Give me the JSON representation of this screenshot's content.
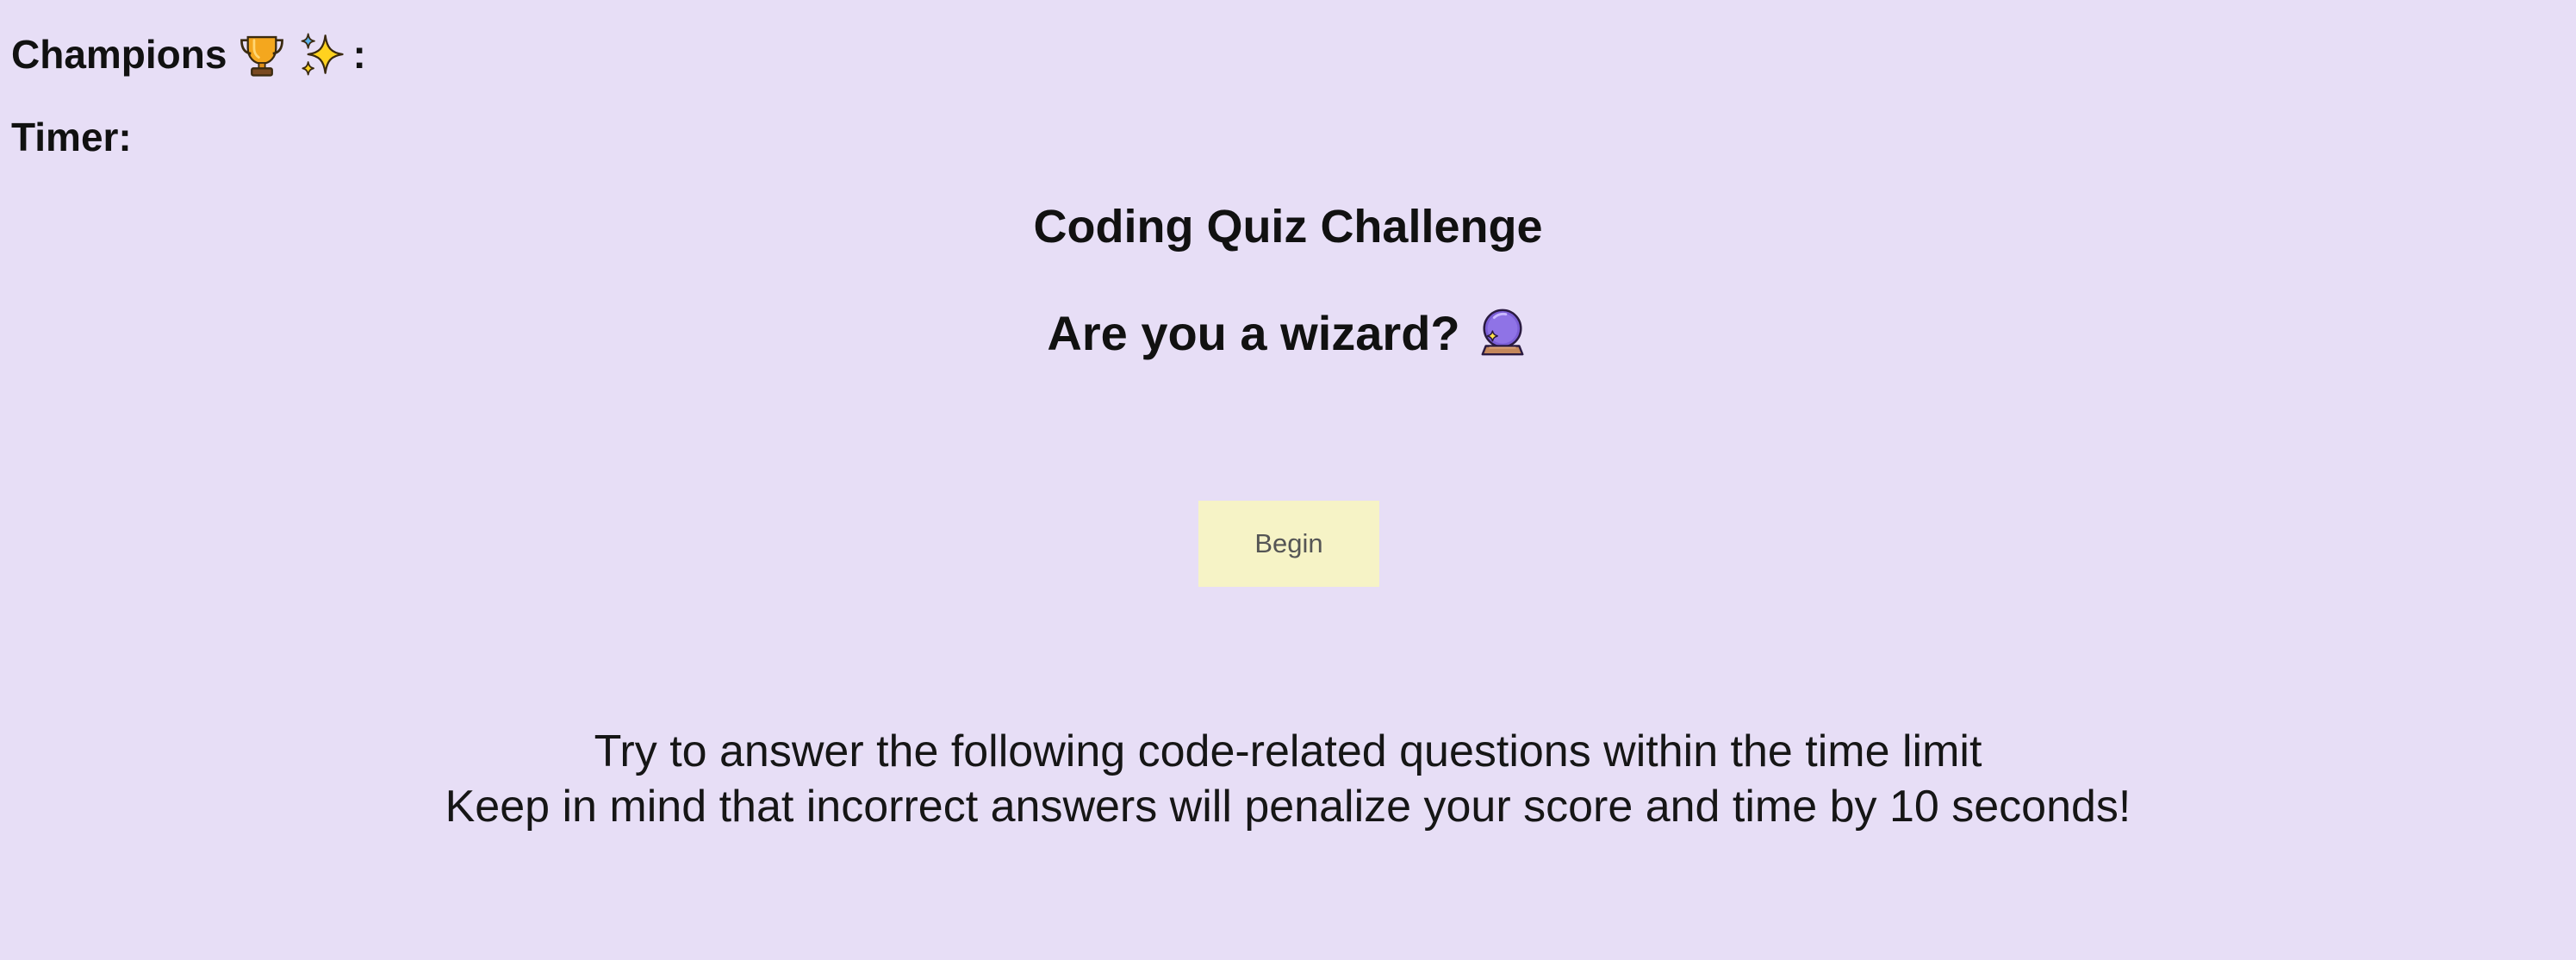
{
  "header": {
    "champions_label": "Champions",
    "champions_icons": [
      "trophy-icon",
      "sparkles-icon"
    ],
    "champions_suffix": ":",
    "timer_label": "Timer:",
    "timer_value": ""
  },
  "quiz": {
    "title": "Coding Quiz Challenge",
    "subtitle": "Are you a wizard?",
    "subtitle_icon": "crystal-ball-icon",
    "begin_label": "Begin",
    "instructions_line1": "Try to answer the following code-related questions within the time limit",
    "instructions_line2": "Keep in mind that incorrect answers will penalize your score and time by 10 seconds!"
  },
  "colors": {
    "background": "#e7def6",
    "button_background": "#f6f3c6",
    "button_text": "#555555",
    "text": "#111111"
  }
}
